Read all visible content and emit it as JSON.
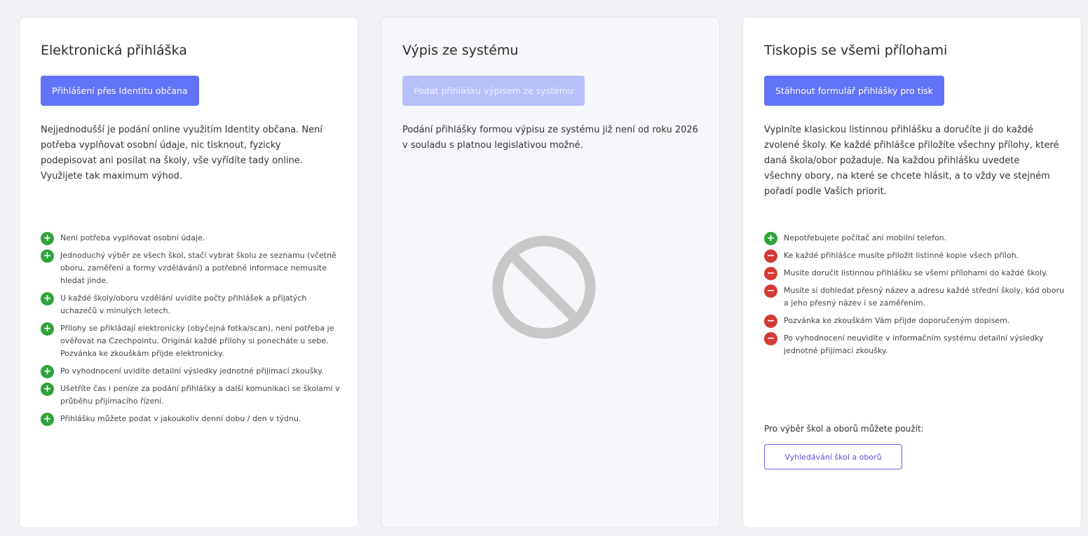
{
  "cards": [
    {
      "title": "Elektronická přihláška",
      "button": "Přihlášení přes Identitu občana",
      "description": "Nejjednodušší je podání online využitím Identity občana. Není potřeba vyplňovat osobní údaje, nic tisknout, fyzicky podepisovat ani posílat na školy, vše vyřídíte tady online. Využijete tak maximum výhod.",
      "features": [
        {
          "type": "plus",
          "text": "Není potřeba vyplňovat osobní údaje."
        },
        {
          "type": "plus",
          "text": "Jednoduchý výběr ze všech škol, stačí vybrat školu ze seznamu (včetně oboru, zaměření a formy vzdělávání) a potřebné informace nemusíte hledat jinde."
        },
        {
          "type": "plus",
          "text": "U každé školy/oboru vzdělání uvidíte počty přihlášek a přijatých uchazečů v minulých letech."
        },
        {
          "type": "plus",
          "text": "Přílohy se přikládají elektronicky (obyčejná fotka/scan), není potřeba je ověřovat na Czechpointu. Originál každé přílohy si ponecháte u sebe. Pozvánka ke zkouškám přijde elektronicky."
        },
        {
          "type": "plus",
          "text": "Po vyhodnocení uvidíte detailní výsledky jednotné přijímací zkoušky."
        },
        {
          "type": "plus",
          "text": "Ušetříte čas i peníze za podání přihlášky a další komunikaci se školami v průběhu přijímacího řízení."
        },
        {
          "type": "plus",
          "text": "Přihlášku můžete podat v jakoukoliv denní dobu / den v týdnu."
        }
      ]
    },
    {
      "title": "Výpis ze systému",
      "button": "Podat přihlášku výpisem ze systému",
      "description": "Podání přihlášky formou výpisu ze systému již není od roku 2026 v souladu s platnou legislativou možné.",
      "icon": "blocked-icon"
    },
    {
      "title": "Tiskopis se všemi přílohami",
      "button": "Stáhnout formulář přihlášky pro tisk",
      "description": "Vyplníte klasickou listinnou přihlášku a doručíte ji do každé zvolené školy. Ke každé přihlášce přiložíte všechny přílohy, které daná škola/obor požaduje. Na každou přihlášku uvedete všechny obory, na které se chcete hlásit, a to vždy ve stejném pořadí podle Vašich priorit.",
      "features": [
        {
          "type": "plus",
          "text": "Nepotřebujete počítač ani mobilní telefon."
        },
        {
          "type": "minus",
          "text": "Ke každé přihlášce musíte přiložit listinné kopie všech příloh."
        },
        {
          "type": "minus",
          "text": "Musíte doručit listinnou přihlášku se všemi přílohami do každé školy."
        },
        {
          "type": "minus",
          "text": "Musíte si dohledat přesný název a adresu každé střední školy, kód oboru a jeho přesný název i se zaměřením."
        },
        {
          "type": "minus",
          "text": "Pozvánka ke zkouškám Vám přijde doporučeným dopisem."
        },
        {
          "type": "minus",
          "text": "Po vyhodnocení neuvidíte v informačním systému detailní výsledky jednotné přijímací zkoušky."
        }
      ],
      "search_hint": "Pro výběr škol a oborů můžete použít:",
      "search_button": "Vyhledávání škol a oborů"
    }
  ],
  "colors": {
    "primary": "#6173f6",
    "primary_disabled": "#b7c0fb",
    "plus": "#2fa33a",
    "minus": "#d33a35",
    "outline": "#6a63e8"
  }
}
